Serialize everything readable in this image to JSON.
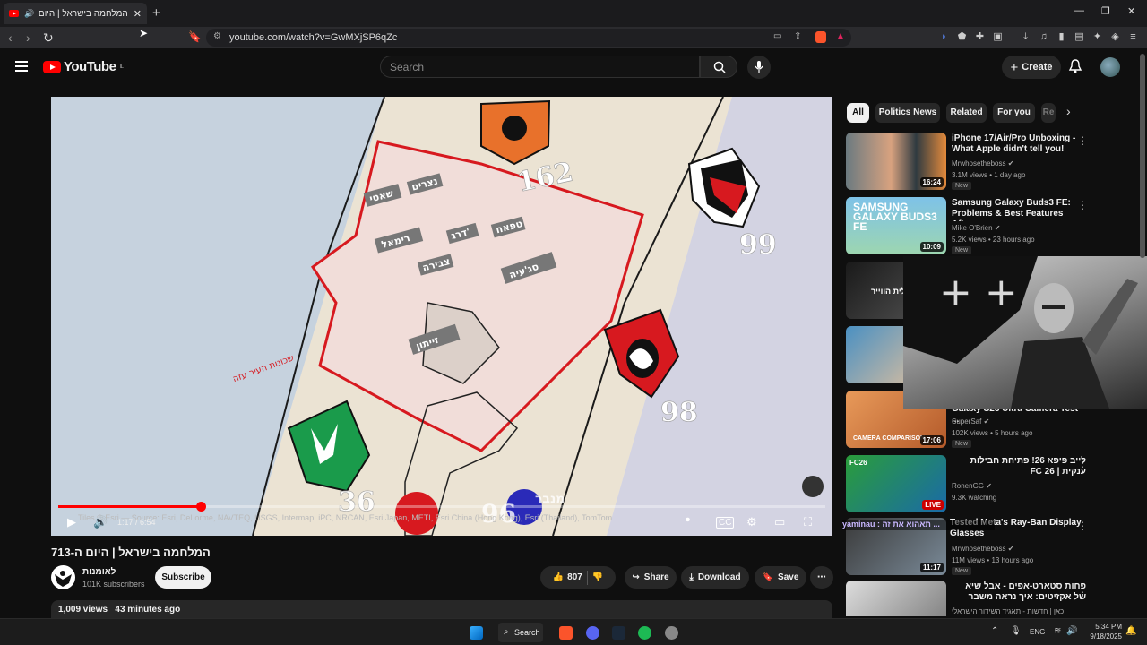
{
  "browser": {
    "tab_title": "המלחמה בישראל | היום ה-713",
    "url": "youtube.com/watch?v=GwMXjSP6qZc"
  },
  "youtube": {
    "logo": "YouTube",
    "logo_region": "IL",
    "search_placeholder": "Search",
    "create_label": "Create"
  },
  "video": {
    "time": "1:17 / 6:54",
    "progress_fraction": 0.186,
    "title": "המלחמה בישראל | היום ה-713",
    "channel_name": "לאומנות",
    "channel_subs": "101K subscribers",
    "subscribe_label": "Subscribe",
    "likes": "807",
    "share_label": "Share",
    "download_label": "Download",
    "save_label": "Save",
    "views": "1,009 views",
    "posted": "43 minutes ago",
    "map_labels": {
      "div_162": "162",
      "div_99": "99",
      "div_98": "98",
      "div_36": "36",
      "div_96": "96",
      "place_1": "סג'עיה",
      "place_2": "זייתון",
      "place_3": "רימאל",
      "place_4": "שאטי",
      "place_5": "נצרים",
      "place_6": "צבירה",
      "place_7": "דרג'",
      "place_8": "טפאח",
      "place_9": "שכונות העיר עזה",
      "logo_text_1": "מנבר",
      "map_credit": "Tiles © Esri — Source: Esri, DeLorme, NAVTEQ, USGS, Intermap, iPC, NRCAN, Esri Japan, METI, Esri China (Hong Kong), Esri (Thailand), TomTom"
    }
  },
  "chips": [
    "All",
    "Politics News",
    "Related",
    "For you",
    "Re"
  ],
  "recommendations": [
    {
      "title": "iPhone 17/Air/Pro Unboxing - What Apple didn't tell you!",
      "channel": "Mrwhosetheboss",
      "meta": "3.1M views • 1 day ago",
      "badge": "New",
      "duration": "16:24"
    },
    {
      "title": "Samsung Galaxy Buds3 FE: Problems & Best Features Afte...",
      "channel": "Mike O'Brien",
      "meta": "5.2K views • 23 hours ago",
      "badge": "New",
      "duration": "10:09",
      "thumb_text": "SAMSUNG GALAXY BUDS3 FE"
    },
    {
      "title": "",
      "channel": "",
      "meta": "",
      "badge": "",
      "duration": "",
      "thumb_text": "ישראלית הווייר"
    },
    {
      "title": "",
      "channel": "",
      "meta": "",
      "badge": "",
      "duration": ""
    },
    {
      "title": "Galaxy S25 Ultra Camera Test ...",
      "channel": "SuperSaf",
      "meta": "102K views • 5 hours ago",
      "badge": "New",
      "duration": "17:06",
      "thumb_text": "CAMERA COMPARISON"
    },
    {
      "title": "לייב פיפא 26! פתיחת חבילות ענקית | FC 26",
      "channel": "RonenGG",
      "meta": "9.3K watching",
      "badge": "",
      "duration": "LIVE",
      "thumb_text": "FC26"
    },
    {
      "title": "Tested Meta's Ray-Ban Display Glasses",
      "channel": "Mrwhosetheboss",
      "meta": "11M views • 13 hours ago",
      "badge": "New",
      "duration": "11:17"
    },
    {
      "title": "פחות סטארט-אפים - אבל שיא של אקזיטים: איך נראה משבר ההייטק",
      "channel": "כאן | חדשות - תאגיד השידור הישראלי",
      "meta": "",
      "badge": "",
      "duration": ""
    }
  ],
  "overlay_chat": "yaminau : תאהוא את זה ...",
  "taskbar": {
    "search_label": "Search",
    "lang": "ENG",
    "time": "5:34 PM",
    "date": "9/18/2025"
  }
}
